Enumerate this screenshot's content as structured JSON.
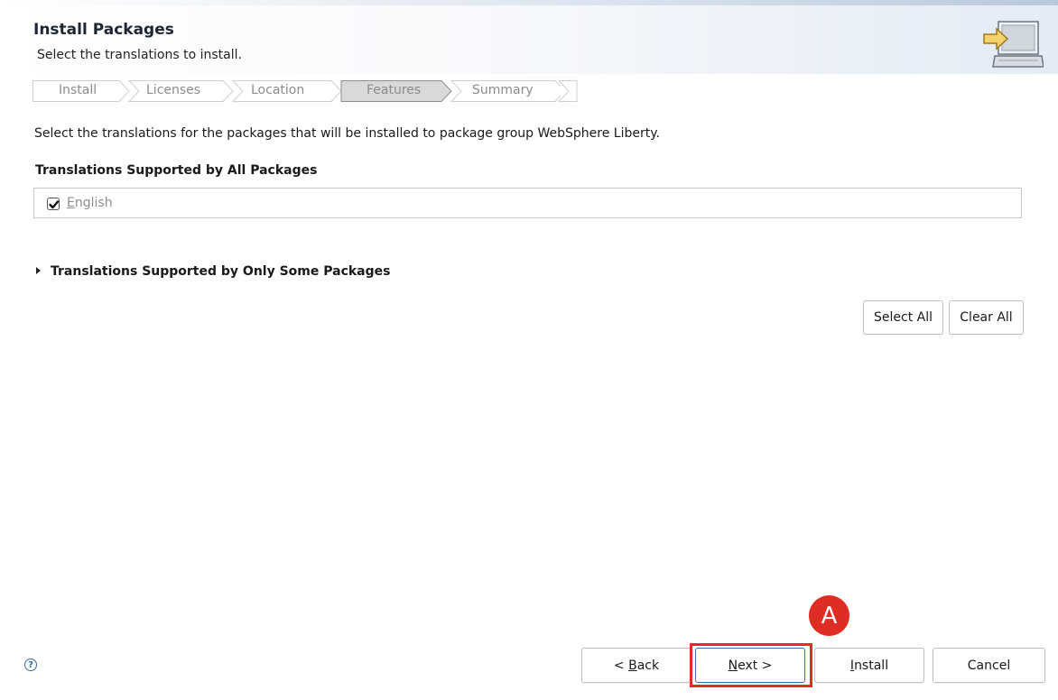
{
  "header": {
    "title": "Install Packages",
    "subtitle": "Select the translations to install.",
    "graphic_icon": "install-wizard-computer-arrow-icon"
  },
  "steps": [
    {
      "label": "Install",
      "state": "done"
    },
    {
      "label": "Licenses",
      "state": "done"
    },
    {
      "label": "Location",
      "state": "done"
    },
    {
      "label": "Features",
      "state": "current"
    },
    {
      "label": "Summary",
      "state": "pending"
    }
  ],
  "intro": "Select the translations for the packages that will be installed to package group WebSphere Liberty.",
  "section_all": {
    "title": "Translations Supported by All Packages",
    "items": [
      {
        "label_first": "E",
        "label_rest": "nglish",
        "checked": true
      }
    ]
  },
  "section_some": {
    "title": "Translations Supported by Only Some Packages",
    "expanded": false
  },
  "buttons": {
    "select_all": "Select All",
    "clear_all": "Clear All",
    "back_prefix": "< ",
    "back_mnemonic": "B",
    "back_rest": "ack",
    "next_mnemonic": "N",
    "next_rest": "ext >",
    "install_mnemonic": "I",
    "install_rest": "nstall",
    "cancel": "Cancel"
  },
  "annotation": {
    "marker": "A",
    "color": "#e02d23"
  },
  "help": {
    "icon": "help-icon",
    "glyph": "?"
  },
  "colors": {
    "accent_border": "#3d6fb0",
    "highlight": "#e02d23"
  }
}
